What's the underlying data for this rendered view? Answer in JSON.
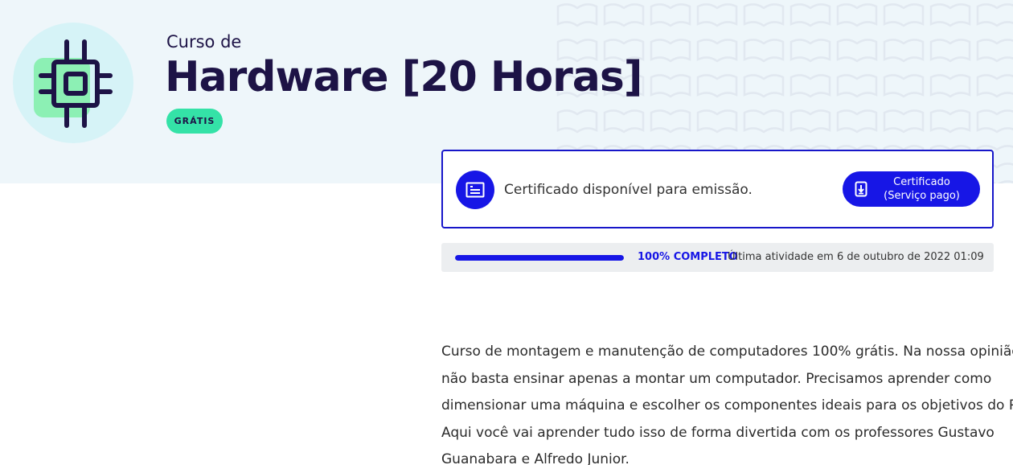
{
  "course": {
    "prefix": "Curso de",
    "title": "Hardware [20 Horas]",
    "badge": "GRÁTIS",
    "icon": "chip-icon"
  },
  "certificate": {
    "message": "Certificado disponível para emissão.",
    "icon": "certificate-icon",
    "button": {
      "line1": "Certificado",
      "line2": "(Serviço pago)",
      "icon": "download-icon"
    }
  },
  "progress": {
    "value": 1.0,
    "percent_label": "100% COMPLETO",
    "activity": "Última atividade em 6 de outubro de 2022 01:09"
  },
  "description": {
    "lines": [
      "Curso de montagem e manutenção de computadores 100% grátis. Na nossa opinião,",
      "não basta ensinar apenas a montar um computador. Precisamos aprender como",
      "dimensionar uma máquina e escolher os componentes ideais para os objetivos do PC.",
      "Aqui você vai aprender tudo isso de forma divertida com os professores Gustavo",
      "Guanabara e Alfredo Junior."
    ]
  },
  "colors": {
    "primary": "#1716e6",
    "title": "#1d1346",
    "badge": "#34e2a7",
    "hero_bg": "#eef6fa"
  }
}
